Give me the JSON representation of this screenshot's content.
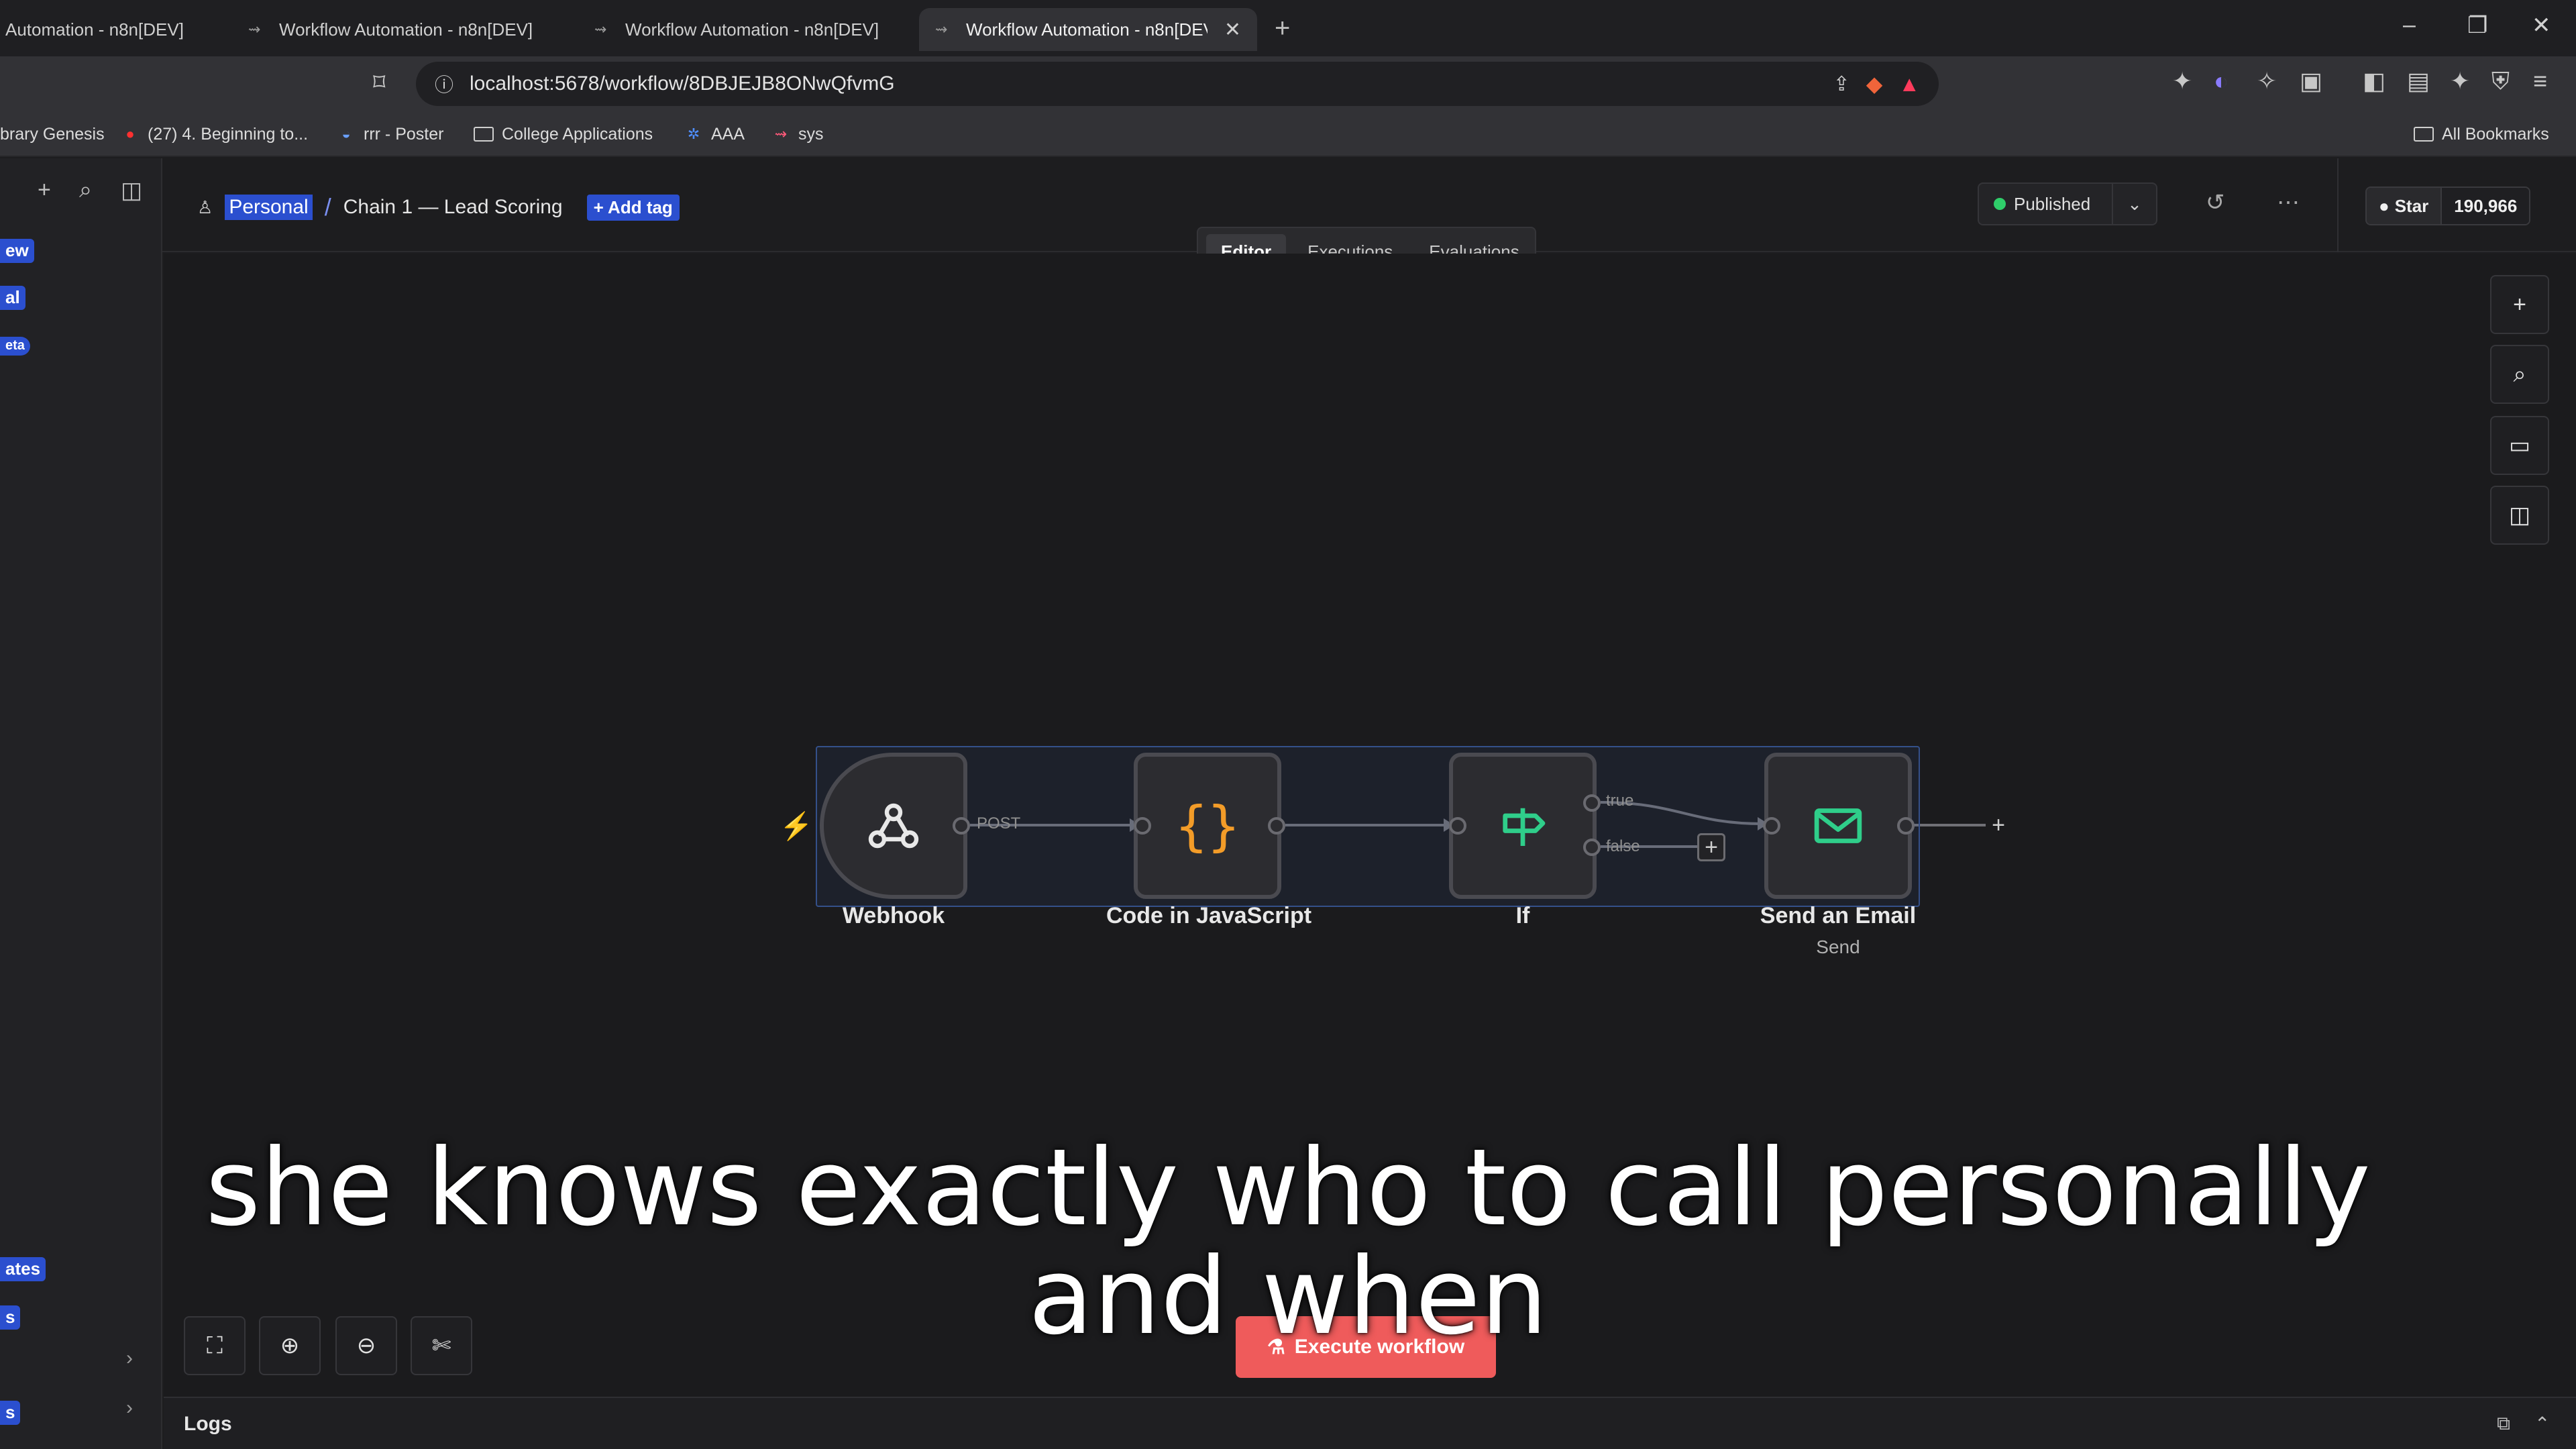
{
  "browser": {
    "tabs": [
      {
        "title": "Automation - n8n[DEV]",
        "active": false
      },
      {
        "title": "Workflow Automation - n8n[DEV]",
        "active": false
      },
      {
        "title": "Workflow Automation - n8n[DEV]",
        "active": false
      },
      {
        "title": "Workflow Automation - n8n[DEV",
        "active": true
      }
    ],
    "url": "localhost:5678/workflow/8DBJEJB8ONwQfvmG",
    "bookmarks": [
      {
        "label": "brary Genesis"
      },
      {
        "label": "(27) 4. Beginning to..."
      },
      {
        "label": "rrr - Poster"
      },
      {
        "label": "College Applications"
      },
      {
        "label": "AAA"
      },
      {
        "label": "sys"
      }
    ],
    "all_bookmarks": "All Bookmarks"
  },
  "sidebar": {
    "fragments": [
      "ew",
      "al",
      "eta",
      "ates",
      "s",
      "s"
    ]
  },
  "header": {
    "project": "Personal",
    "separator": "/",
    "workflow_name": "Chain 1 — Lead Scoring",
    "add_tag": "+ Add tag",
    "tabs": [
      "Editor",
      "Executions",
      "Evaluations"
    ],
    "status": "Published",
    "github_star": "Star",
    "github_count": "190,966"
  },
  "workflow": {
    "nodes": [
      {
        "name": "Webhook",
        "subtitle": "",
        "icon": "webhook-icon"
      },
      {
        "name": "Code in JavaScript",
        "subtitle": "",
        "icon": "code-braces-icon"
      },
      {
        "name": "If",
        "subtitle": "",
        "icon": "signpost-icon"
      },
      {
        "name": "Send an Email",
        "subtitle": "Send",
        "icon": "mail-icon"
      }
    ],
    "edge_labels": {
      "webhook_output": "POST",
      "if_true": "true",
      "if_false": "false"
    }
  },
  "canvas": {
    "execute_button": "Execute workflow"
  },
  "logs": {
    "label": "Logs"
  },
  "caption": {
    "line1": "she knows exactly who to call personally",
    "line2": "and when"
  },
  "colors": {
    "accent_blue": "#2b4fcf",
    "execute_red": "#ef5b5b",
    "published_green": "#2fce6a",
    "code_orange": "#f39c28",
    "node_green": "#2fce8a"
  }
}
